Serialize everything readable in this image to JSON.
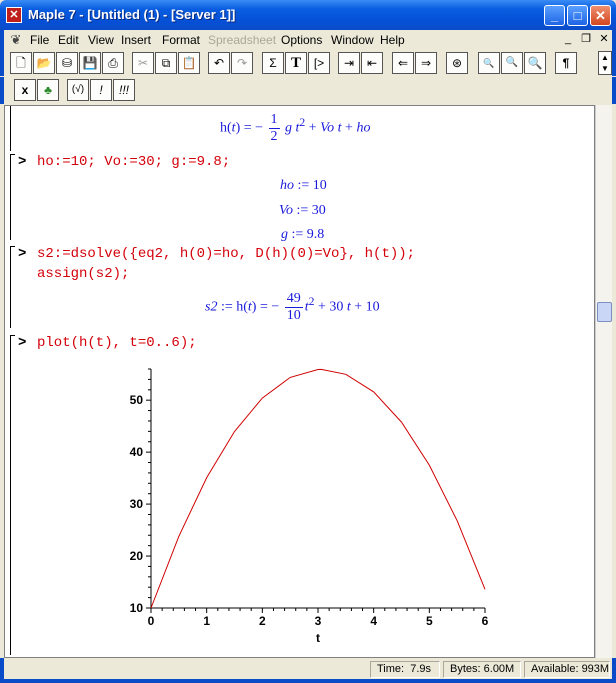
{
  "window": {
    "app_icon": "maple-leaf-icon",
    "title": "Maple 7  - [Untitled (1) - [Server 1]]"
  },
  "menu": {
    "items": [
      {
        "label": "File",
        "underline": "F"
      },
      {
        "label": "Edit",
        "underline": "E"
      },
      {
        "label": "View",
        "underline": "V"
      },
      {
        "label": "Insert",
        "underline": "I"
      },
      {
        "label": "Format",
        "underline": "o"
      },
      {
        "label": "Spreadsheet",
        "disabled": true
      },
      {
        "label": "Options",
        "underline": "O"
      },
      {
        "label": "Window",
        "underline": "W"
      },
      {
        "label": "Help",
        "underline": "H"
      }
    ]
  },
  "toolbar1": {
    "buttons": [
      "new-icon",
      "open-icon",
      "open-url-icon",
      "save-icon",
      "print-icon",
      "cut-icon",
      "copy-icon",
      "paste-icon",
      "undo-icon",
      "redo-icon",
      "sigma-icon",
      "text-T-icon",
      "exec-group-icon",
      "indent-icon",
      "outdent-icon",
      "back-icon",
      "forward-icon",
      "stop-icon",
      "zoom-small-icon",
      "zoom-medium-icon",
      "zoom-large-icon",
      "pilcrow-icon"
    ]
  },
  "toolbar2": {
    "buttons": [
      "x-icon",
      "maple-leaf-icon",
      "sqrt-icon",
      "exclaim-icon",
      "triple-exclaim-icon"
    ],
    "labels": [
      "x",
      "♣",
      "(√)",
      "!",
      "!!!"
    ]
  },
  "worksheet": {
    "eq_top": "h(t) = − ½ g t² + Vo t + ho",
    "prompt": ">",
    "cmd1": "ho:=10; Vo:=30; g:=9.8;",
    "out1": [
      "ho := 10",
      "Vo := 30",
      "g := 9.8"
    ],
    "cmd2_line1": "s2:=dsolve({eq2, h(0)=ho, D(h)(0)=Vo}, h(t));",
    "cmd2_line2": "assign(s2);",
    "out2": "s2 := h(t) = − 49/10 t² + 30 t + 10",
    "cmd3": "plot(h(t), t=0..6);"
  },
  "chart_data": {
    "type": "line",
    "title": "",
    "xlabel": "t",
    "ylabel": "",
    "xlim": [
      0,
      6
    ],
    "ylim": [
      10,
      56
    ],
    "xticks": [
      0,
      1,
      2,
      3,
      4,
      5,
      6
    ],
    "yticks": [
      10,
      20,
      30,
      40,
      50
    ],
    "series": [
      {
        "color": "#d00000",
        "expression": "h(t) = -49/10 t^2 + 30 t + 10",
        "x": [
          0,
          0.5,
          1,
          1.5,
          2,
          2.5,
          3,
          3.06,
          3.5,
          4,
          4.5,
          5,
          5.5,
          6
        ],
        "y": [
          10,
          23.78,
          35.1,
          43.98,
          50.4,
          54.38,
          55.9,
          55.92,
          54.98,
          51.6,
          45.78,
          37.5,
          26.78,
          13.6
        ]
      }
    ]
  },
  "status": {
    "time_label": "Time:",
    "time_value": "7.9s",
    "bytes_label": "Bytes:",
    "bytes_value": "6.00M",
    "available_label": "Available:",
    "available_value": "993M"
  }
}
